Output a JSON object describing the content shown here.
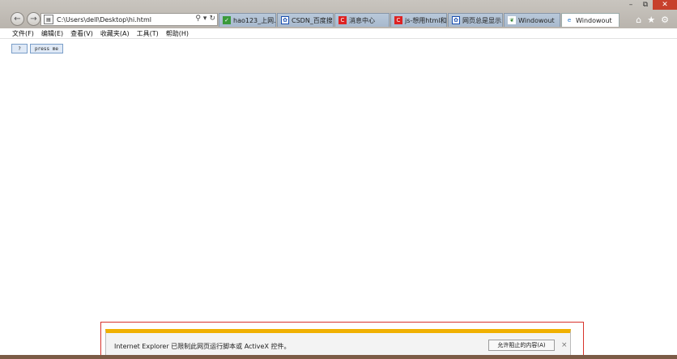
{
  "window": {
    "minimize_glyph": "–",
    "restore_glyph": "⧉",
    "close_glyph": "✕"
  },
  "address_bar": {
    "url": "C:\\Users\\dell\\Desktop\\hi.html",
    "search_glyph": "⚲",
    "dropdown_glyph": "▾",
    "refresh_glyph": "↻"
  },
  "tabs": [
    {
      "label": "hao123_上网...",
      "icon": "hao123-icon"
    },
    {
      "label": "CSDN_百度搜索",
      "icon": "baidu-paw-icon"
    },
    {
      "label": "消息中心",
      "icon": "csdn-icon"
    },
    {
      "label": "js-想用html和J...",
      "icon": "csdn-icon"
    },
    {
      "label": "网页总是显示...",
      "icon": "baidu-paw-icon"
    },
    {
      "label": "Windowout",
      "icon": "leaf-icon"
    },
    {
      "label": "Windowout",
      "icon": "ie-icon",
      "active": true
    }
  ],
  "toolbar_icons": [
    "home-icon",
    "favorites-star-icon",
    "settings-gear-icon"
  ],
  "menu": [
    "文件(F)",
    "编辑(E)",
    "查看(V)",
    "收藏夹(A)",
    "工具(T)",
    "帮助(H)"
  ],
  "page": {
    "button_q": "?",
    "button_press": "press me"
  },
  "notification": {
    "message": "Internet Explorer 已限制此网页运行脚本或 ActiveX 控件。",
    "allow_button": "允许阻止的内容(A)",
    "close_glyph": "×"
  },
  "colors": {
    "chrome": "#c9c5bf",
    "tab_inactive": "#b9c9da",
    "notification_accent": "#f0b000",
    "highlight_frame": "#d8332b"
  }
}
